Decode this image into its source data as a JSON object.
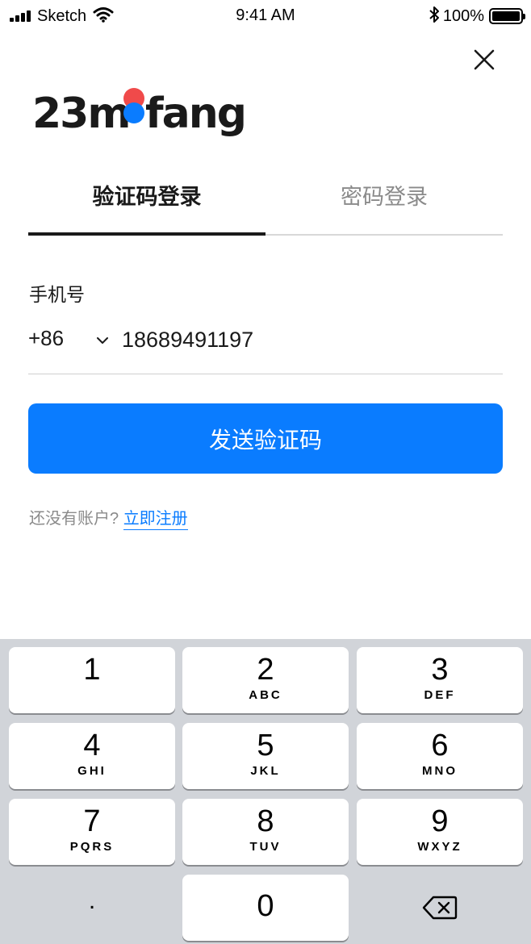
{
  "status_bar": {
    "carrier": "Sketch",
    "time": "9:41 AM",
    "battery": "100%",
    "battery_level": 1.0
  },
  "icons": {
    "close": "close-icon",
    "bluetooth": "bluetooth-icon",
    "wifi": "wifi-icon",
    "chevron": "chevron-down-icon",
    "delete": "delete-backspace-icon"
  },
  "brand": {
    "logo_text": "23mofang",
    "logo_colors": [
      "#f04a4a",
      "#0a7cff"
    ]
  },
  "tabs": [
    {
      "label": "验证码登录",
      "active": true
    },
    {
      "label": "密码登录",
      "active": false
    }
  ],
  "form": {
    "phone_label": "手机号",
    "country_code": "+86",
    "phone_value": "18689491197",
    "send_button": "发送验证码"
  },
  "register": {
    "prompt": "还没有账户?",
    "link": "立即注册"
  },
  "keyboard": {
    "keys": [
      {
        "digit": "1",
        "letters": ""
      },
      {
        "digit": "2",
        "letters": "ABC"
      },
      {
        "digit": "3",
        "letters": "DEF"
      },
      {
        "digit": "4",
        "letters": "GHI"
      },
      {
        "digit": "5",
        "letters": "JKL"
      },
      {
        "digit": "6",
        "letters": "MNO"
      },
      {
        "digit": "7",
        "letters": "PQRS"
      },
      {
        "digit": "8",
        "letters": "TUV"
      },
      {
        "digit": "9",
        "letters": "WXYZ"
      },
      {
        "digit": ".",
        "letters": ""
      },
      {
        "digit": "0",
        "letters": ""
      }
    ]
  },
  "colors": {
    "accent": "#0a7cff",
    "text": "#1a1a1a",
    "muted": "#8a8a8a",
    "keyboard_bg": "#d1d4d9"
  }
}
